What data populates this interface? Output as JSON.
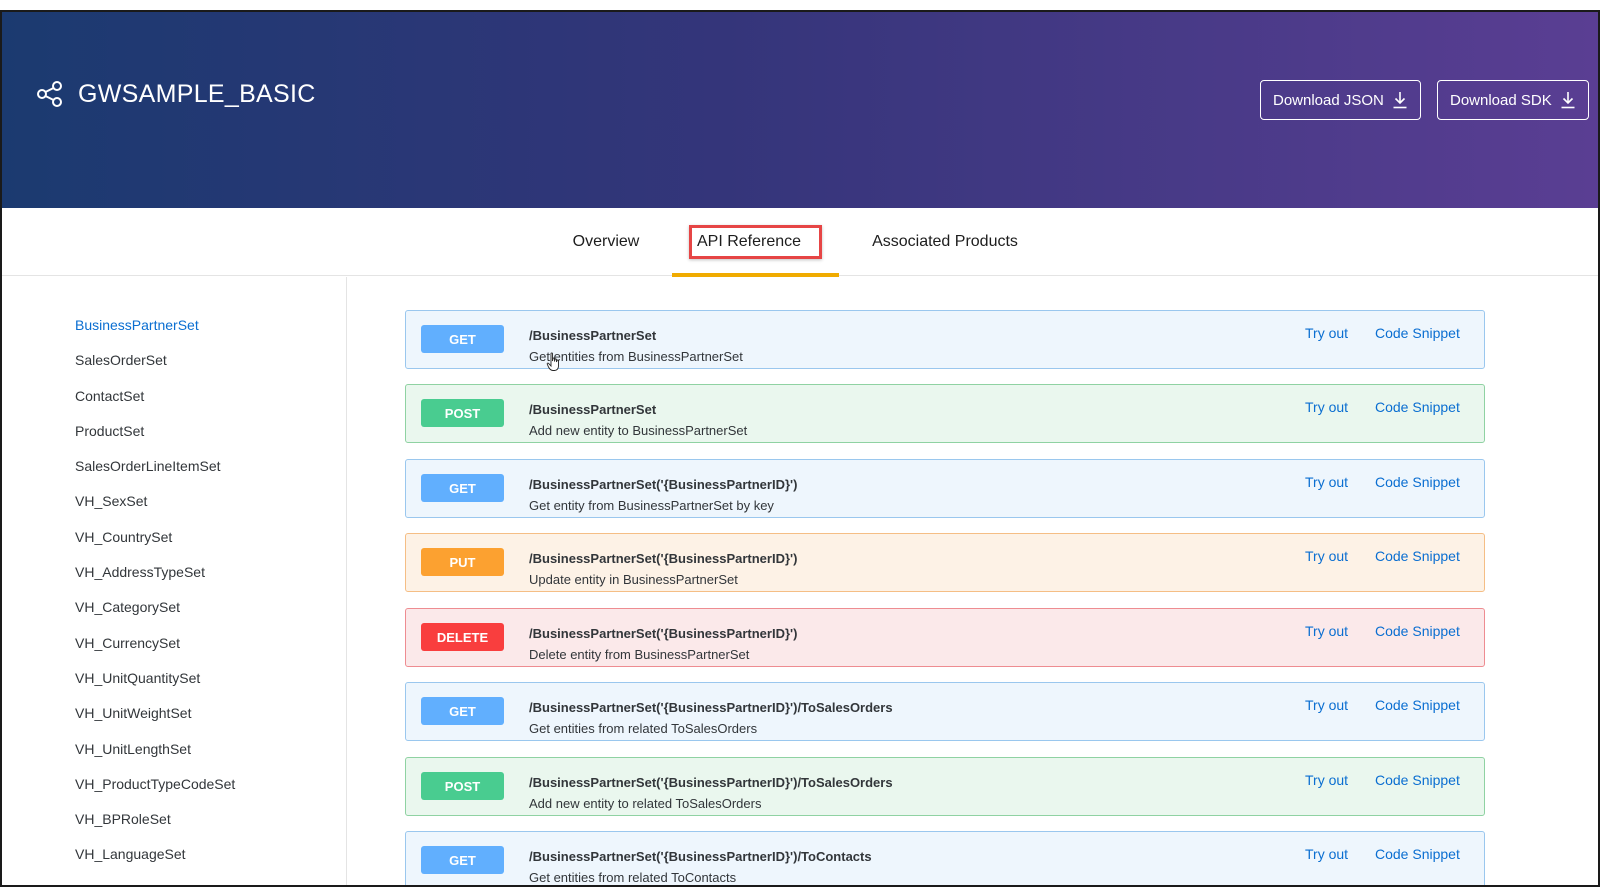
{
  "header": {
    "title": "GWSAMPLE_BASIC",
    "download_json_label": "Download JSON",
    "download_sdk_label": "Download SDK",
    "colors": {
      "gradient_start": "#1b3a70",
      "gradient_end": "#5a3e93"
    }
  },
  "tabs": [
    {
      "label": "Overview",
      "active": false
    },
    {
      "label": "API Reference",
      "active": true
    },
    {
      "label": "Associated Products",
      "active": false
    }
  ],
  "sidebar": {
    "items": [
      {
        "label": "BusinessPartnerSet",
        "active": true
      },
      {
        "label": "SalesOrderSet"
      },
      {
        "label": "ContactSet"
      },
      {
        "label": "ProductSet"
      },
      {
        "label": "SalesOrderLineItemSet"
      },
      {
        "label": "VH_SexSet"
      },
      {
        "label": "VH_CountrySet"
      },
      {
        "label": "VH_AddressTypeSet"
      },
      {
        "label": "VH_CategorySet"
      },
      {
        "label": "VH_CurrencySet"
      },
      {
        "label": "VH_UnitQuantitySet"
      },
      {
        "label": "VH_UnitWeightSet"
      },
      {
        "label": "VH_UnitLengthSet"
      },
      {
        "label": "VH_ProductTypeCodeSet"
      },
      {
        "label": "VH_BPRoleSet"
      },
      {
        "label": "VH_LanguageSet"
      }
    ]
  },
  "operations": [
    {
      "method": "GET",
      "path": "/BusinessPartnerSet",
      "description": "Get entities from BusinessPartnerSet",
      "try_out": "Try out",
      "code_snippet": "Code Snippet"
    },
    {
      "method": "POST",
      "path": "/BusinessPartnerSet",
      "description": "Add new entity to BusinessPartnerSet",
      "try_out": "Try out",
      "code_snippet": "Code Snippet"
    },
    {
      "method": "GET",
      "path": "/BusinessPartnerSet('{BusinessPartnerID}')",
      "description": "Get entity from BusinessPartnerSet by key",
      "try_out": "Try out",
      "code_snippet": "Code Snippet"
    },
    {
      "method": "PUT",
      "path": "/BusinessPartnerSet('{BusinessPartnerID}')",
      "description": "Update entity in BusinessPartnerSet",
      "try_out": "Try out",
      "code_snippet": "Code Snippet"
    },
    {
      "method": "DELETE",
      "path": "/BusinessPartnerSet('{BusinessPartnerID}')",
      "description": "Delete entity from BusinessPartnerSet",
      "try_out": "Try out",
      "code_snippet": "Code Snippet"
    },
    {
      "method": "GET",
      "path": "/BusinessPartnerSet('{BusinessPartnerID}')/ToSalesOrders",
      "description": "Get entities from related ToSalesOrders",
      "try_out": "Try out",
      "code_snippet": "Code Snippet"
    },
    {
      "method": "POST",
      "path": "/BusinessPartnerSet('{BusinessPartnerID}')/ToSalesOrders",
      "description": "Add new entity to related ToSalesOrders",
      "try_out": "Try out",
      "code_snippet": "Code Snippet"
    },
    {
      "method": "GET",
      "path": "/BusinessPartnerSet('{BusinessPartnerID}')/ToContacts",
      "description": "Get entities from related ToContacts",
      "try_out": "Try out",
      "code_snippet": "Code Snippet"
    }
  ],
  "colors": {
    "get": "#61affe",
    "post": "#49cc90",
    "put": "#fca130",
    "delete": "#f93e3e",
    "link": "#0a6ed1",
    "active_tab_underline": "#f0ab00",
    "highlight_box": "#e64545"
  }
}
